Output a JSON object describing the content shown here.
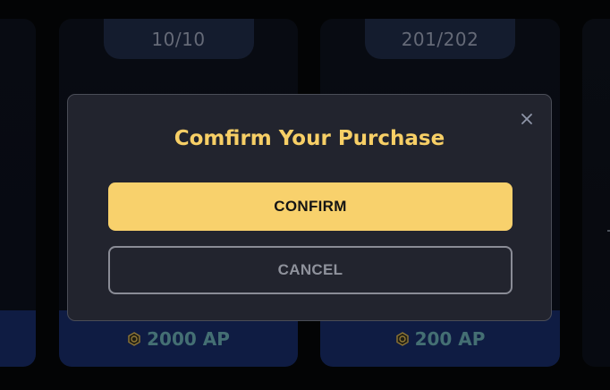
{
  "cards": [
    {
      "stock": "",
      "price": ""
    },
    {
      "stock": "10/10",
      "price": "2000 AP"
    },
    {
      "stock": "201/202",
      "price": "200 AP"
    },
    {
      "stock": "",
      "price": ""
    }
  ],
  "modal": {
    "title": "Comfirm Your Purchase",
    "confirm_label": "CONFIRM",
    "cancel_label": "CANCEL"
  },
  "colors": {
    "accent": "#f8d16c",
    "title": "#f7cf66",
    "modal_bg": "#22242e",
    "price_bar": "#15285d",
    "price_text": "#5f9aa0"
  },
  "icons": {
    "close": "close-icon",
    "currency": "ap-coin-icon"
  }
}
